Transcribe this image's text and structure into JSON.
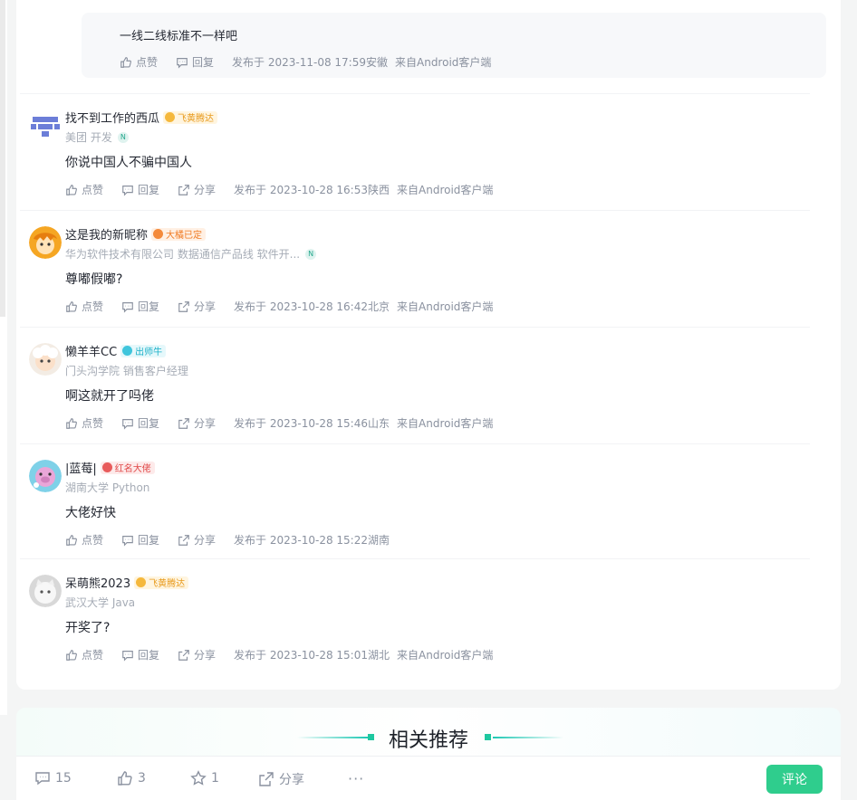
{
  "reply": {
    "text": "一线二线标准不一样吧",
    "like": "点赞",
    "reply": "回复",
    "time": "发布于 2023-11-08 17:59",
    "location": "安徽",
    "source": "来自Android客户端"
  },
  "comments": [
    {
      "name": "找不到工作的西瓜",
      "badge": "飞黄腾达",
      "badge_style": "gold",
      "org": "美团 开发",
      "n_badge": "N",
      "text": "你说中国人不骗中国人",
      "like": "点赞",
      "reply": "回复",
      "share": "分享",
      "time": "发布于 2023-10-28 16:53",
      "location": "陕西",
      "source": "来自Android客户端"
    },
    {
      "name": "这是我的新昵称",
      "badge": "大橘已定",
      "badge_style": "orange",
      "org": "华为软件技术有限公司 数据通信产品线 软件开...",
      "n_badge": "N",
      "text": "尊嘟假嘟?",
      "like": "点赞",
      "reply": "回复",
      "share": "分享",
      "time": "发布于 2023-10-28 16:42",
      "location": "北京",
      "source": "来自Android客户端"
    },
    {
      "name": "懒羊羊CC",
      "badge": "出师牛",
      "badge_style": "teal",
      "org": "门头沟学院 销售客户经理",
      "text": "啊这就开了吗佬",
      "like": "点赞",
      "reply": "回复",
      "share": "分享",
      "time": "发布于 2023-10-28 15:46",
      "location": "山东",
      "source": "来自Android客户端"
    },
    {
      "name": "|蓝莓|",
      "badge": "红名大佬",
      "badge_style": "red",
      "org": "湖南大学 Python",
      "text": "大佬好快",
      "like": "点赞",
      "reply": "回复",
      "share": "分享",
      "time": "发布于 2023-10-28 15:22",
      "location": "湖南",
      "source": ""
    },
    {
      "name": "呆萌熊2023",
      "badge": "飞黄腾达",
      "badge_style": "gold",
      "org": "武汉大学 Java",
      "text": "开奖了?",
      "like": "点赞",
      "reply": "回复",
      "share": "分享",
      "time": "发布于 2023-10-28 15:01",
      "location": "湖北",
      "source": "来自Android客户端"
    }
  ],
  "recommend": {
    "title": "相关推荐"
  },
  "bottombar": {
    "comments_count": "15",
    "likes_count": "3",
    "stars_count": "1",
    "share_label": "分享",
    "more_label": "···",
    "comment_button": "评论"
  },
  "colors": {
    "accent": "#2fcd8d",
    "text": "#252933",
    "muted": "#8a919f"
  }
}
